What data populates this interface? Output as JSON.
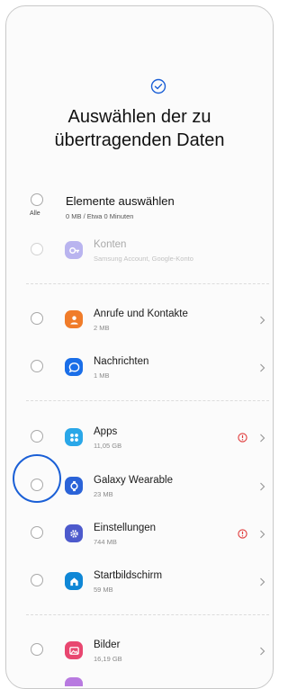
{
  "header": {
    "title_line1": "Auswählen der zu",
    "title_line2": "übertragenden Daten"
  },
  "select_all": {
    "label": "Elemente auswählen",
    "sub": "0 MB / Etwa 0 Minuten",
    "radio_label": "Alle"
  },
  "items": [
    {
      "title": "Konten",
      "sub": "Samsung Account, Google-Konto",
      "icon": "key-icon",
      "color": "#b9b4ef",
      "disabled": true
    },
    {
      "title": "Anrufe und Kontakte",
      "sub": "2 MB",
      "icon": "contacts-icon",
      "color": "#f07c2a"
    },
    {
      "title": "Nachrichten",
      "sub": "1 MB",
      "icon": "messages-icon",
      "color": "#1a6ee8"
    },
    {
      "title": "Apps",
      "sub": "11,05 GB",
      "icon": "apps-icon",
      "color": "#2aa7e8",
      "warning": true
    },
    {
      "title": "Galaxy Wearable",
      "sub": "23 MB",
      "icon": "wearable-icon",
      "color": "#2b63d8"
    },
    {
      "title": "Einstellungen",
      "sub": "744 MB",
      "icon": "settings-icon",
      "color": "#4d5acc",
      "warning": true
    },
    {
      "title": "Startbildschirm",
      "sub": "59 MB",
      "icon": "home-icon",
      "color": "#0f87d6"
    },
    {
      "title": "Bilder",
      "sub": "16,19 GB",
      "icon": "pictures-icon",
      "color": "#e84770"
    }
  ],
  "colors": {
    "accent": "#1a5fd6",
    "warning": "#e03a3a"
  }
}
